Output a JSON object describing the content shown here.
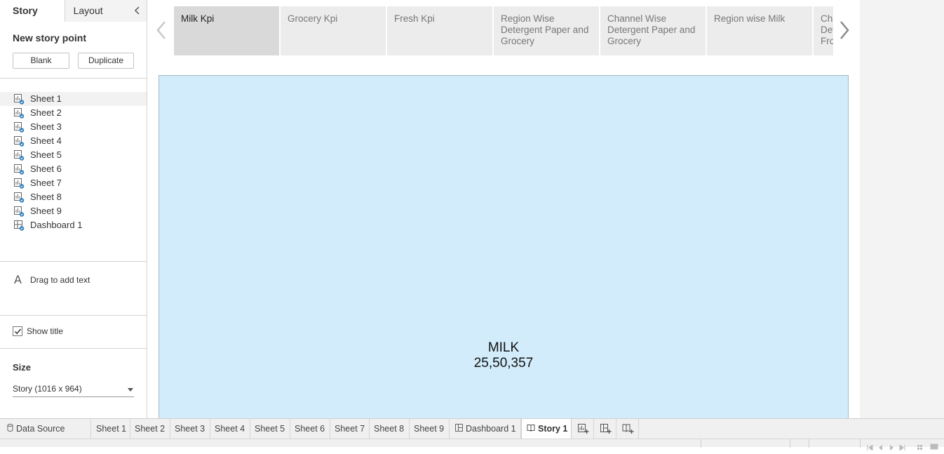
{
  "panel": {
    "tabs": [
      "Story",
      "Layout"
    ],
    "new_story_point": "New story point",
    "blank_button": "Blank",
    "duplicate_button": "Duplicate",
    "sheets": [
      "Sheet 1",
      "Sheet 2",
      "Sheet 3",
      "Sheet 4",
      "Sheet 5",
      "Sheet 6",
      "Sheet 7",
      "Sheet 8",
      "Sheet 9",
      "Dashboard 1"
    ],
    "drag_text": "Drag to add text",
    "show_title": "Show title",
    "show_title_checked": true,
    "size_title": "Size",
    "size_value": "Story (1016 x 964)"
  },
  "story_points": [
    {
      "label": "Milk Kpi",
      "selected": true
    },
    {
      "label": "Grocery Kpi",
      "selected": false
    },
    {
      "label": "Fresh Kpi",
      "selected": false
    },
    {
      "label": "Region Wise Detergent Paper and Grocery",
      "selected": false
    },
    {
      "label": "Channel Wise Detergent Paper and Grocery",
      "selected": false
    },
    {
      "label": "Region wise Milk",
      "selected": false
    },
    {
      "label": "Channel Wise Detergent Paper and Frozen",
      "selected": false
    }
  ],
  "kpi": {
    "label": "MILK",
    "value": "25,50,357",
    "background": "#d2ecfb"
  },
  "bottom_tabs": {
    "data_source": "Data Source",
    "sheets": [
      "Sheet 1",
      "Sheet 2",
      "Sheet 3",
      "Sheet 4",
      "Sheet 5",
      "Sheet 6",
      "Sheet 7",
      "Sheet 8",
      "Sheet 9"
    ],
    "dashboard": "Dashboard 1",
    "story": "Story 1"
  },
  "icons": {
    "worksheet": "worksheet-icon",
    "dashboard": "dashboard-icon",
    "story": "story-icon",
    "new_worksheet": "new-worksheet-icon",
    "new_dashboard": "new-dashboard-icon",
    "new_story": "new-story-icon"
  }
}
